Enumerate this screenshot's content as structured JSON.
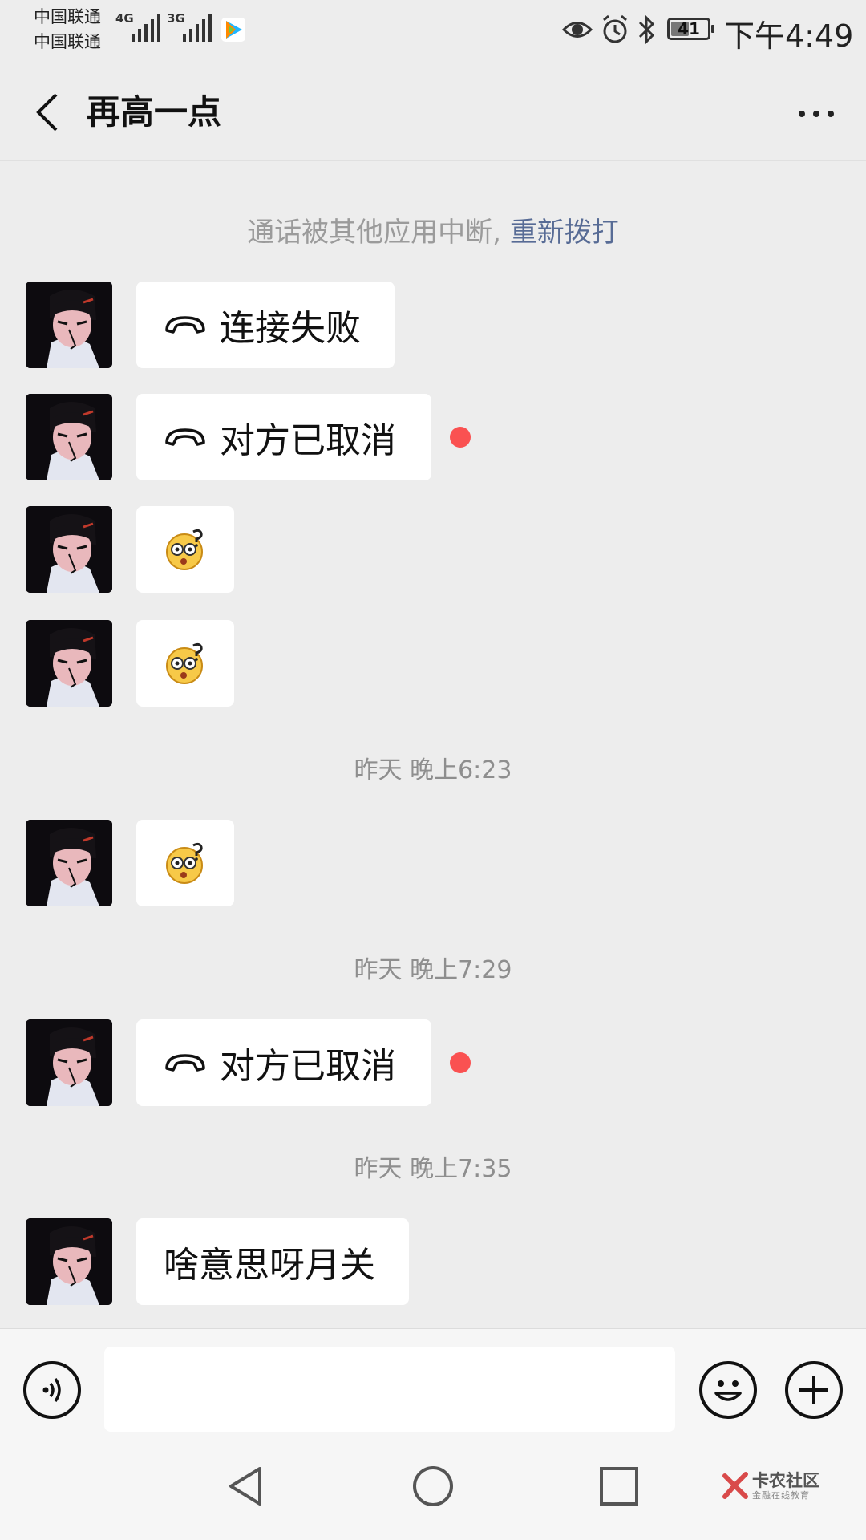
{
  "status_bar": {
    "carrier_1": "中国联通",
    "carrier_2": "中国联通",
    "network_1": "4G",
    "network_2": "3G",
    "battery": "41",
    "time": "下午4:49",
    "icons": [
      "eye-icon",
      "alarm-icon",
      "bluetooth-icon",
      "battery-icon"
    ]
  },
  "header": {
    "title": "再高一点",
    "back_icon": "chevron-left-icon",
    "more_icon": "more-dots-icon"
  },
  "system_notice": {
    "text": "通话被其他应用中断, ",
    "link": "重新拨打"
  },
  "messages": [
    {
      "type": "call",
      "text": "连接失败",
      "unread_dot": false
    },
    {
      "type": "call",
      "text": "对方已取消",
      "unread_dot": true
    },
    {
      "type": "emoji",
      "emoji": "dizzy-question-face"
    },
    {
      "type": "emoji",
      "emoji": "dizzy-question-face"
    },
    {
      "type": "timestamp",
      "text": "昨天 晚上6:23"
    },
    {
      "type": "emoji",
      "emoji": "dizzy-question-face"
    },
    {
      "type": "timestamp",
      "text": "昨天 晚上7:29"
    },
    {
      "type": "call",
      "text": "对方已取消",
      "unread_dot": true
    },
    {
      "type": "timestamp",
      "text": "昨天 晚上7:35"
    },
    {
      "type": "text",
      "text": "啥意思呀月关"
    }
  ],
  "input_bar": {
    "value": "",
    "voice_icon": "voice-icon",
    "emoji_icon": "smiley-icon",
    "plus_icon": "plus-icon"
  },
  "watermark": {
    "title": "卡农社区",
    "subtitle": "金融在线教育"
  },
  "colors": {
    "background": "#ededed",
    "link": "#576b95",
    "unread_dot": "#fa5151"
  }
}
